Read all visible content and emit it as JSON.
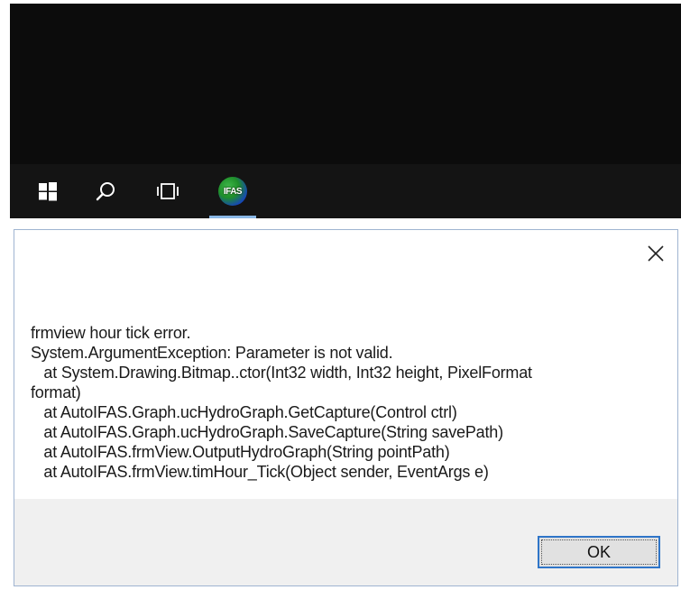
{
  "taskbar": {
    "start_icon": "windows-start-icon",
    "search_icon": "search-icon",
    "taskview_icon": "task-view-icon",
    "app": {
      "icon": "autoifas-app-icon",
      "icon_text": "IFAS"
    },
    "colors": {
      "background": "#141414",
      "desktop": "#0c0c0c",
      "active_underline": "#8ab8e6"
    }
  },
  "dialog": {
    "close_label": "✕",
    "message_lines": [
      "frmview hour tick error.",
      "System.ArgumentException: Parameter is not valid.",
      "   at System.Drawing.Bitmap..ctor(Int32 width, Int32 height, PixelFormat",
      "format)",
      "   at AutoIFAS.Graph.ucHydroGraph.GetCapture(Control ctrl)",
      "   at AutoIFAS.Graph.ucHydroGraph.SaveCapture(String savePath)",
      "   at AutoIFAS.frmView.OutputHydroGraph(String pointPath)",
      "   at AutoIFAS.frmView.timHour_Tick(Object sender, EventArgs e)"
    ],
    "ok_label": "OK",
    "colors": {
      "border": "#9fb4d1",
      "footer": "#f0f0f0",
      "ok_border": "#2f75c8"
    }
  }
}
